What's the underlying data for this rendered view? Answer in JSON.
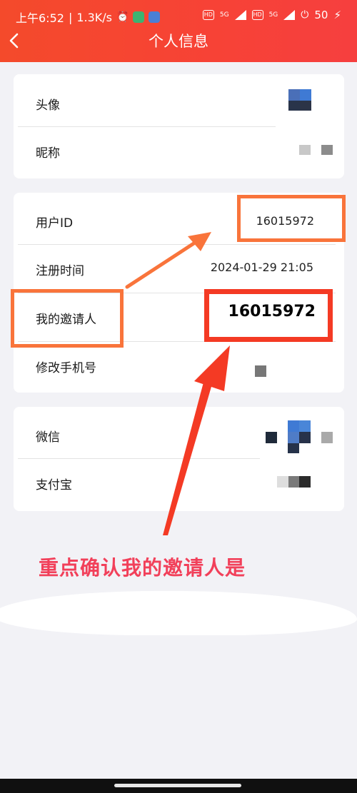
{
  "status_bar": {
    "time": "上午6:52",
    "speed": "1.3K/s",
    "net1": "5G",
    "net2": "5G",
    "battery": "50"
  },
  "header": {
    "title": "个人信息"
  },
  "card1": {
    "avatar_label": "头像",
    "nickname_label": "昵称"
  },
  "card2": {
    "userid_label": "用户ID",
    "userid_value": "16015972",
    "register_label": "注册时间",
    "register_value": "2024-01-29 21:05",
    "inviter_label": "我的邀请人",
    "inviter_value": "16015972",
    "phone_label": "修改手机号"
  },
  "card3": {
    "wechat_label": "微信",
    "alipay_label": "支付宝"
  },
  "annotation": {
    "text": "重点确认我的邀请人是",
    "colors": {
      "orange": "#f9743b",
      "red": "#f43a24",
      "text": "#f2405a"
    }
  }
}
